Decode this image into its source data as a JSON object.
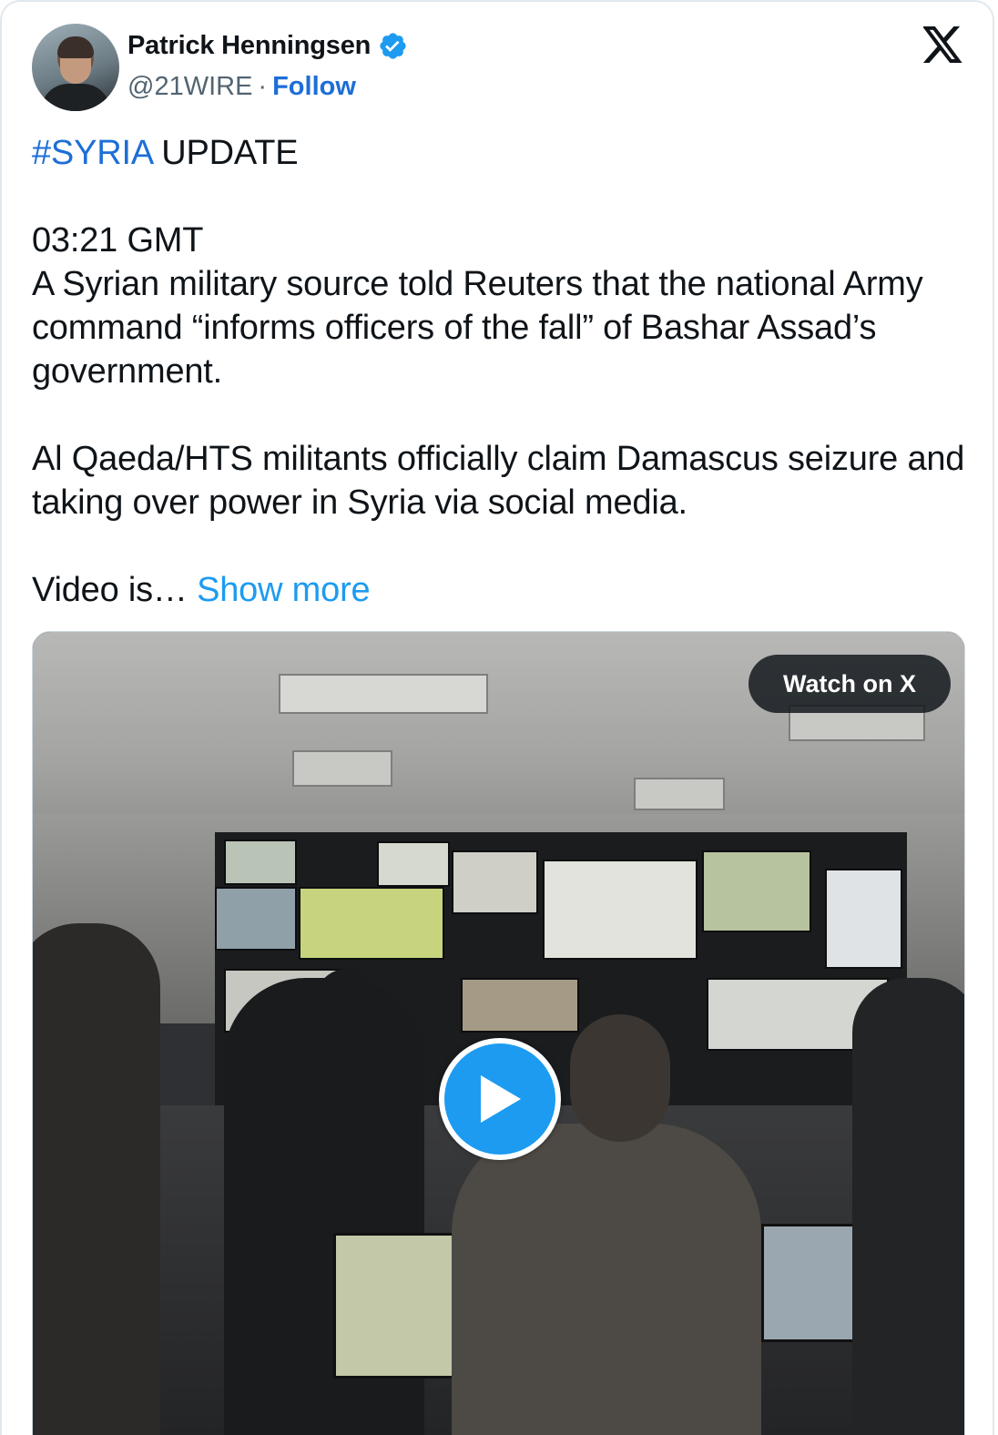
{
  "author": {
    "display_name": "Patrick Henningsen",
    "handle": "@21WIRE",
    "separator": "·",
    "follow_label": "Follow",
    "verified": true
  },
  "brand": {
    "logo_icon": "x-logo-icon"
  },
  "tweet": {
    "hashtag": "#SYRIA",
    "line1_rest": " UPDATE",
    "time": "03:21 GMT",
    "paragraph1": "A Syrian military source told Reuters that the national Army command “informs officers of the fall” of Bashar Assad’s government.",
    "paragraph2": "Al Qaeda/HTS militants officially claim Damascus seizure and taking over power in Syria via social media.",
    "truncated": "Video is… ",
    "show_more_label": "Show more"
  },
  "media": {
    "type": "video",
    "watch_label": "Watch on X",
    "play_icon": "play-icon"
  },
  "colors": {
    "link_blue": "#1d6ed8",
    "show_more_blue": "#1d9bf0",
    "verified_blue": "#1d9bf0",
    "text": "#0f1419",
    "secondary": "#536471"
  }
}
